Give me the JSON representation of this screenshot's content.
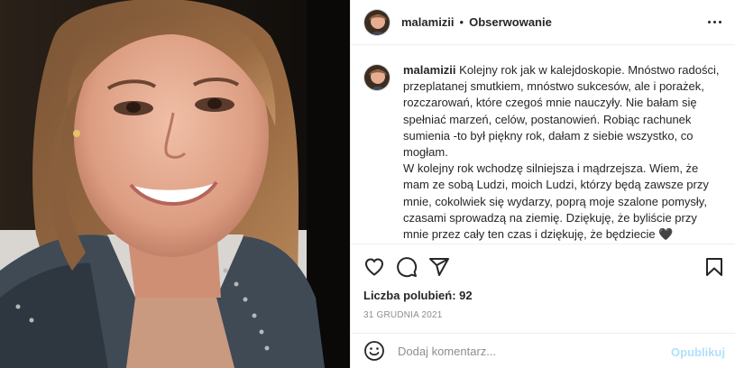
{
  "header": {
    "username": "malamizii",
    "separator": "•",
    "follow_label": "Obserwowanie"
  },
  "caption": {
    "username": "malamizii",
    "text": "Kolejny rok jak w kalejdoskopie. Mnóstwo radości, przeplatanej smutkiem, mnóstwo sukcesów, ale i porażek, rozczarowań, które czegoś mnie nauczyły. Nie bałam się spełniać marzeń, celów, postanowień. Robiąc rachunek sumienia -to był piękny rok, dałam z siebie wszystko, co mogłam.\nW kolejny rok wchodzę silniejsza i mądrzejsza. Wiem, że mam ze sobą Ludzi, moich Ludzi, którzy będą zawsze przy mnie, cokolwiek się wydarzy, poprą moje szalone pomysły, czasami sprowadzą na ziemię. Dziękuję, że byliście przy mnie przez cały ten czas i dziękuję, że będziecie 🖤\nŻyczę sobie i Wam, żebyśmy zawsze mieli przy sobie takich Ludzi, na których możemy liczyć w każdej sytuacji 🥰 żebyśmy kolejny rok"
  },
  "stats": {
    "likes": "Liczba polubień: 92",
    "date": "31 GRUDNIA 2021"
  },
  "comment": {
    "placeholder": "Dodaj komentarz...",
    "publish_label": "Opublikuj"
  },
  "icons": {
    "like": "heart-icon",
    "comment": "comment-icon",
    "share": "share-icon",
    "save": "bookmark-icon",
    "more": "more-options-icon",
    "emoji": "emoji-icon"
  },
  "colors": {
    "text": "#262626",
    "muted": "#8e8e8e",
    "border": "#efefef",
    "publish_disabled": "#b2dffc"
  }
}
